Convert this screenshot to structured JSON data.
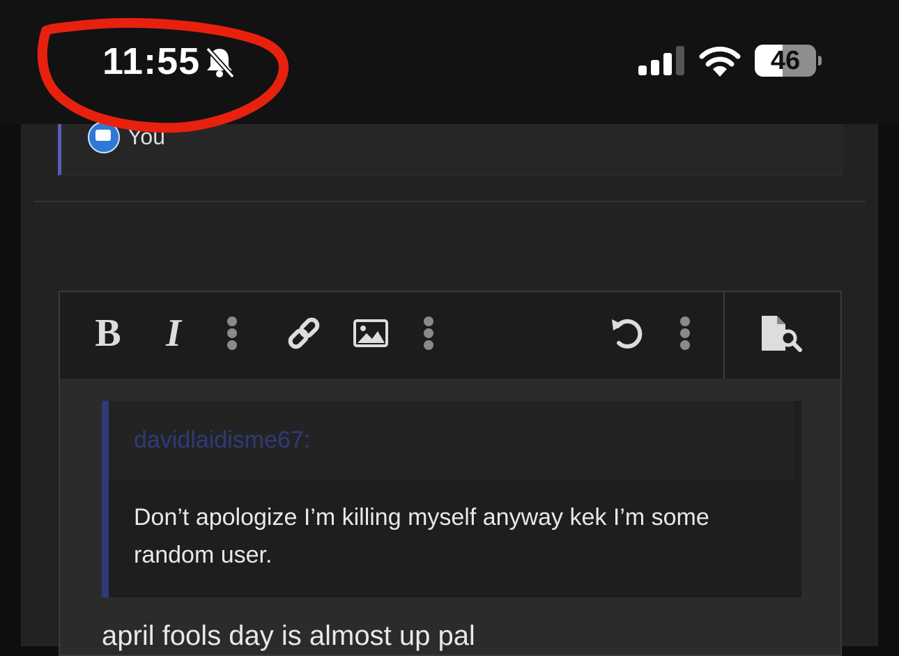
{
  "status_bar": {
    "time": "11:55",
    "battery_level": "46",
    "battery_fraction": 0.46
  },
  "reply_card": {
    "user": "You"
  },
  "editor": {
    "toolbar": {
      "bold_label": "B",
      "italic_label": "I"
    },
    "quote": {
      "author": "davidlaidisme67:",
      "text": "Don’t apologize I’m killing myself anyway kek I’m some random user."
    },
    "compose_text": "april fools day is almost up pal"
  },
  "colors": {
    "annotation": "#e8210f",
    "quote_accent": "#2f3a78",
    "reply_accent": "#5560b6"
  },
  "icons": [
    "bell-slash-icon",
    "signal-icon",
    "wifi-icon",
    "battery-icon",
    "link-icon",
    "image-icon",
    "undo-icon",
    "preview-icon"
  ]
}
